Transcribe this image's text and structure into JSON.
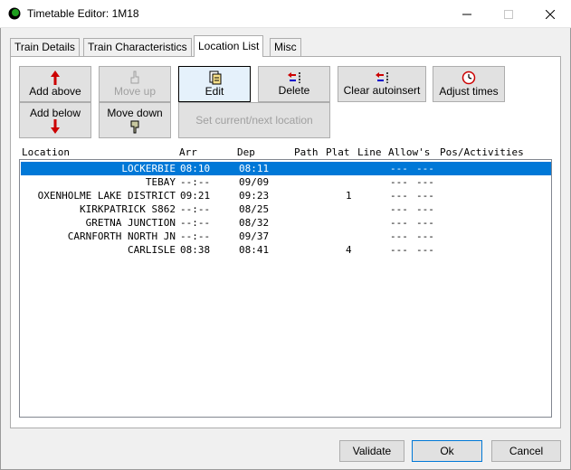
{
  "window": {
    "title": "Timetable Editor: 1M18"
  },
  "tabs": [
    {
      "label": "Train Details"
    },
    {
      "label": "Train Characteristics"
    },
    {
      "label": "Location List"
    },
    {
      "label": "Misc"
    }
  ],
  "toolbar": {
    "add_above": "Add above",
    "add_below": "Add below",
    "move_up": "Move up",
    "move_down": "Move down",
    "edit": "Edit",
    "delete": "Delete",
    "clear_autoinsert": "Clear autoinsert",
    "adjust_times": "Adjust times",
    "set_current": "Set current/next location"
  },
  "columns": {
    "location": "Location",
    "arr": "Arr",
    "dep": "Dep",
    "path": "Path",
    "plat": "Plat",
    "line": "Line",
    "allows": "Allow's",
    "pos": "Pos/Activities"
  },
  "rows": [
    {
      "location": "LOCKERBIE",
      "arr": "08:10",
      "dep": "08:11",
      "plat": "",
      "allows": "---",
      "pos": "---",
      "selected": true
    },
    {
      "location": "TEBAY",
      "arr": "--:--",
      "dep": "09/09",
      "plat": "",
      "allows": "---",
      "pos": "---"
    },
    {
      "location": "OXENHOLME LAKE DISTRICT",
      "arr": "09:21",
      "dep": "09:23",
      "plat": "1",
      "allows": "---",
      "pos": "---"
    },
    {
      "location": "KIRKPATRICK S862",
      "arr": "--:--",
      "dep": "08/25",
      "plat": "",
      "allows": "---",
      "pos": "---"
    },
    {
      "location": "GRETNA JUNCTION",
      "arr": "--:--",
      "dep": "08/32",
      "plat": "",
      "allows": "---",
      "pos": "---"
    },
    {
      "location": "CARNFORTH NORTH JN",
      "arr": "--:--",
      "dep": "09/37",
      "plat": "",
      "allows": "---",
      "pos": "---"
    },
    {
      "location": "CARLISLE",
      "arr": "08:38",
      "dep": "08:41",
      "plat": "4",
      "allows": "---",
      "pos": "---"
    }
  ],
  "footer": {
    "validate": "Validate",
    "ok": "Ok",
    "cancel": "Cancel"
  },
  "colors": {
    "selection": "#0078d7",
    "up_arrow": "#cc0000",
    "app_icon": "#1e9e1e"
  }
}
